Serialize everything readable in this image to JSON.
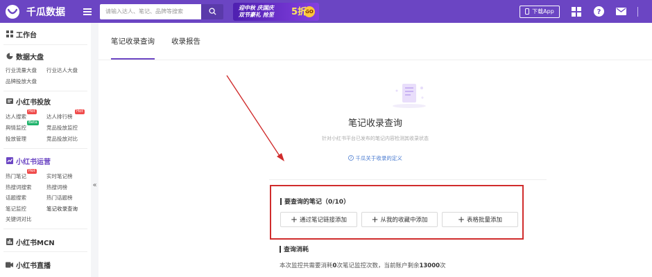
{
  "brand": {
    "name": "千瓜数据"
  },
  "search": {
    "placeholder": "请输入达人、笔记、品牌等搜索"
  },
  "banner": {
    "line1": "迎中秋 庆国庆",
    "line2": "双节豪礼 抢至",
    "discount": "5折",
    "go": "GO"
  },
  "topbar": {
    "app_download": "下载App"
  },
  "sidebar": {
    "workbench": "工作台",
    "dashboard": {
      "title": "数据大盘",
      "links": [
        "行业流量大盘",
        "行业达人大盘",
        "品牌投放大盘"
      ]
    },
    "delivery": {
      "title": "小红书投放",
      "links": [
        {
          "label": "达人搜索",
          "badge": "Hot"
        },
        {
          "label": "达人排行榜",
          "badge": "Hot"
        },
        {
          "label": "舆情监控",
          "badge": "Beta"
        },
        {
          "label": "竞品投放监控",
          "badge": ""
        },
        {
          "label": "投放管理",
          "badge": ""
        },
        {
          "label": "竞品投放对比",
          "badge": ""
        }
      ]
    },
    "operation": {
      "title": "小红书运营",
      "links": [
        {
          "label": "热门笔记",
          "badge": "Hot"
        },
        {
          "label": "实时笔记榜",
          "badge": ""
        },
        {
          "label": "热搜词搜索",
          "badge": ""
        },
        {
          "label": "热搜词榜",
          "badge": ""
        },
        {
          "label": "话题搜索",
          "badge": ""
        },
        {
          "label": "热门话题榜",
          "badge": ""
        },
        {
          "label": "笔记监控",
          "badge": ""
        },
        {
          "label": "笔记收录查询",
          "badge": ""
        },
        {
          "label": "关键词对比",
          "badge": ""
        }
      ]
    },
    "mcn": "小红书MCN",
    "live": "小红书直播",
    "collapse": "«"
  },
  "tabs": [
    {
      "label": "笔记收录查询",
      "active": true
    },
    {
      "label": "收录报告",
      "active": false
    }
  ],
  "empty": {
    "title": "笔记收录查询",
    "subtitle": "针对小红书平台已发布的笔记内容检测其收录状态",
    "help_link": "千瓜关于收录的定义"
  },
  "query": {
    "heading": "要查询的笔记（0/10）",
    "buttons": [
      "通过笔记链接添加",
      "从我的收藏中添加",
      "表格批量添加"
    ]
  },
  "cost": {
    "heading": "查询消耗",
    "text_prefix": "本次监控共需要消耗",
    "consume_count": "0",
    "text_middle": "次笔记监控次数，当前账户剩余",
    "remaining": "13000",
    "text_suffix": "次"
  },
  "colors": {
    "brand": "#6b45c3",
    "highlight_box": "#d02c2c",
    "link": "#4a7bd0"
  }
}
